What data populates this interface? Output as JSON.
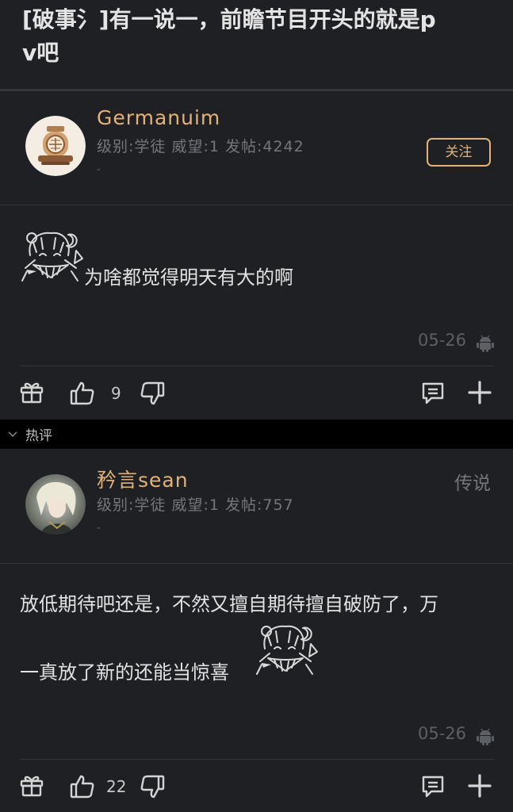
{
  "thread": {
    "title_line1": "[破事氵]有一说一，前瞻节目开头的就是p",
    "title_line2": "v吧"
  },
  "main_post": {
    "username": "Germanuim",
    "meta": "级别:学徒 威望:1 发帖:4242",
    "signature": "-",
    "follow_label": "关注",
    "content": "为啥都觉得明天有大的啊",
    "date": "05-26",
    "like_count": "9"
  },
  "hot_section": {
    "label": "热评"
  },
  "hot_reply": {
    "username": "矜言sean",
    "rank": "传说",
    "meta": "级别:学徒 威望:1 发帖:757",
    "signature": "-",
    "content_line1": "放低期待吧还是，不然又擅自期待擅自破防了，万",
    "content_line2": "一真放了新的还能当惊喜",
    "date": "05-26",
    "like_count": "22"
  },
  "icons": {
    "gift": "gift-icon",
    "like": "thumb-up-icon",
    "dislike": "thumb-down-icon",
    "reply": "comment-icon",
    "more": "plus-icon",
    "platform": "android-icon",
    "collapse": "chevron-down-icon"
  },
  "colors": {
    "background": "#1f2024",
    "accent": "#e2b27a",
    "muted": "#74767b",
    "hot_bar": "#000000"
  }
}
